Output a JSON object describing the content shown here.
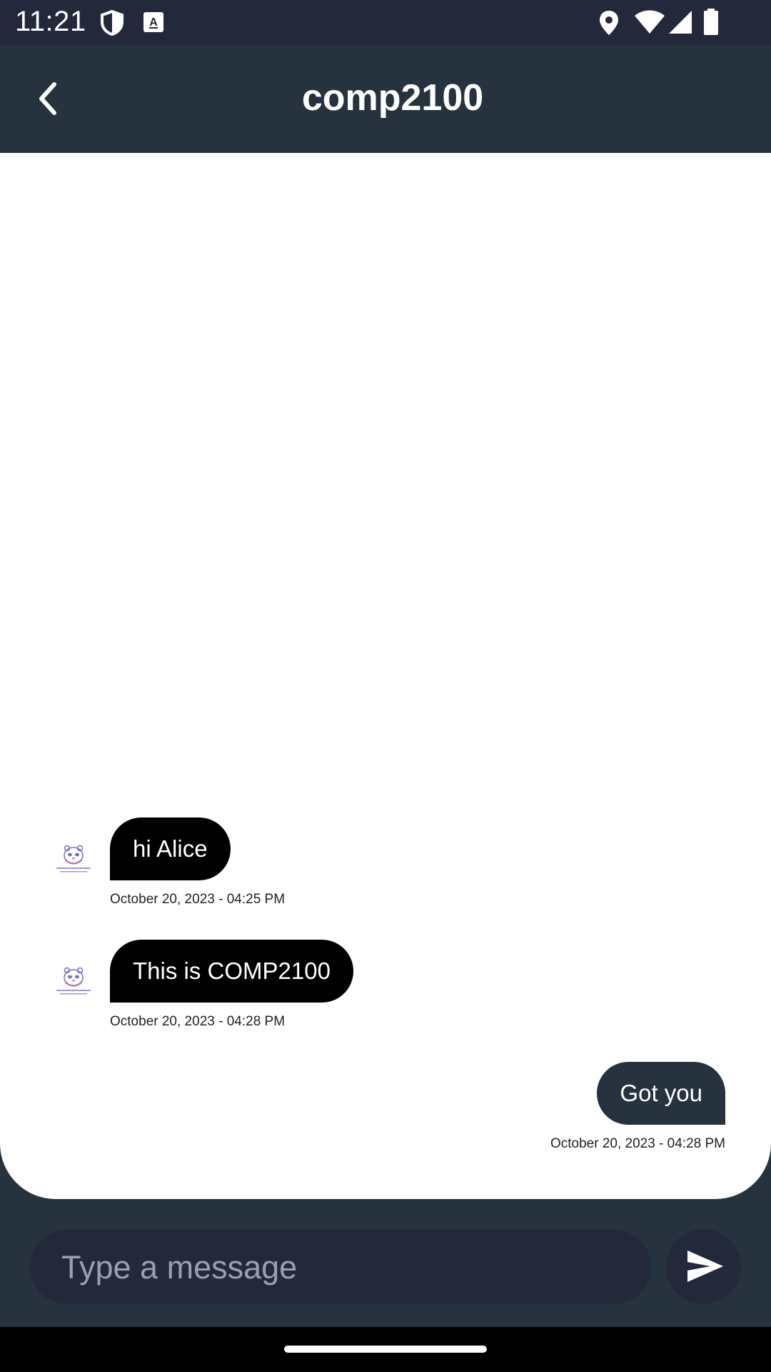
{
  "status_bar": {
    "time": "11:21",
    "icons": [
      "shield-icon",
      "font-a-icon",
      "location-icon",
      "wifi-icon",
      "signal-icon",
      "battery-icon"
    ]
  },
  "header": {
    "title": "comp2100",
    "back_icon": "chevron-left-icon"
  },
  "messages": [
    {
      "direction": "incoming",
      "text": "hi Alice",
      "timestamp": "October 20, 2023 - 04:25 PM"
    },
    {
      "direction": "incoming",
      "text": "This is COMP2100",
      "timestamp": "October 20, 2023 - 04:28 PM"
    },
    {
      "direction": "outgoing",
      "text": "Got you",
      "timestamp": "October 20, 2023 - 04:28 PM"
    }
  ],
  "input": {
    "placeholder": "Type a message",
    "value": ""
  },
  "send_icon": "send-icon",
  "colors": {
    "status_bar_bg": "#23283b",
    "app_bar_bg": "#26323e",
    "chat_bg": "#ffffff",
    "incoming_bubble": "#000000",
    "outgoing_bubble": "#26323e",
    "input_bg": "#23283b"
  }
}
